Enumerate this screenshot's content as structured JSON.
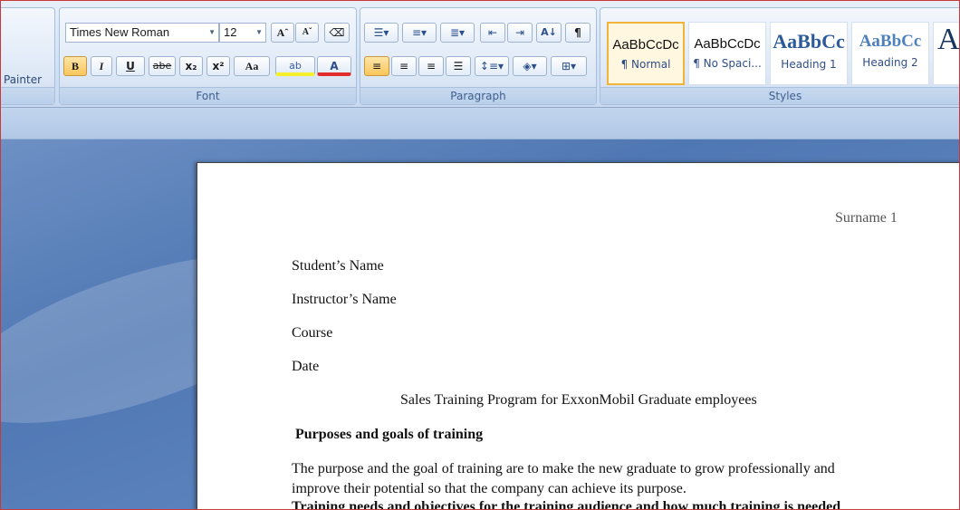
{
  "clipboard": {
    "painter_label": "Painter"
  },
  "font": {
    "group_label": "Font",
    "family": "Times New Roman",
    "size": "12",
    "grow_icon": "Aˆ",
    "shrink_icon": "Aˇ",
    "bold": "B",
    "italic": "I",
    "underline": "U",
    "strikethrough": "abe",
    "subscript": "x₂",
    "superscript": "x²",
    "change_case": "Aa",
    "highlight": "ab",
    "font_color": "A"
  },
  "paragraph": {
    "group_label": "Paragraph",
    "pilcrow": "¶",
    "sort": "A↓"
  },
  "styles": {
    "group_label": "Styles",
    "items": [
      {
        "sample": "AaBbCcDc",
        "name": "¶ Normal"
      },
      {
        "sample": "AaBbCcDc",
        "name": "¶ No Spaci..."
      },
      {
        "sample": "AaBbCc",
        "name": "Heading 1"
      },
      {
        "sample": "AaBbCc",
        "name": "Heading 2"
      },
      {
        "sample": "A",
        "name": ""
      }
    ]
  },
  "document": {
    "header": "Surname 1",
    "lines": {
      "student": "Student’s Name",
      "instructor": "Instructor’s Name",
      "course": "Course",
      "date": "Date"
    },
    "title": "Sales Training Program for ExxonMobil Graduate employees",
    "heading1": "Purposes and goals of training",
    "para1_line1": "The purpose and the goal of training are to make the new graduate to grow professionally and",
    "para1_line2": "improve their potential so that the company can achieve its purpose.",
    "heading2": "Training needs and objectives for the training audience and how much training is needed"
  }
}
